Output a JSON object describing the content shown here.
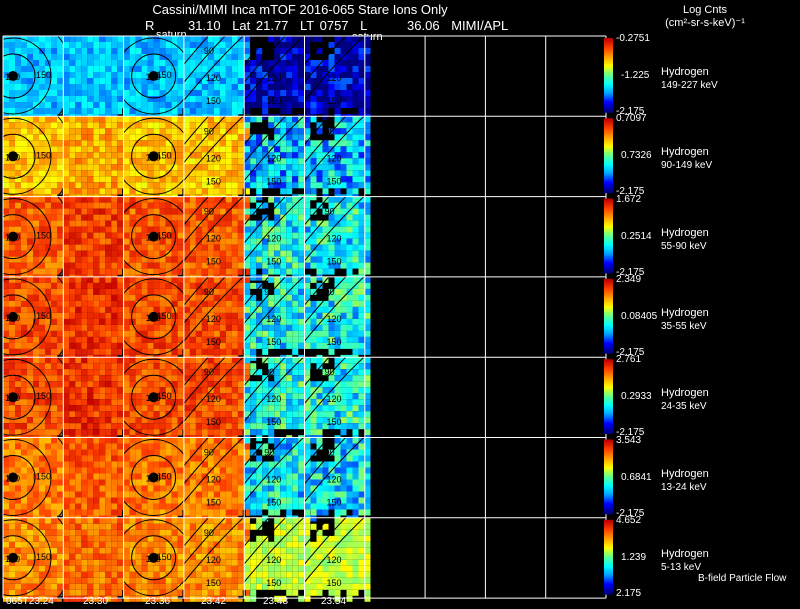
{
  "header": {
    "title": "Cassini/MIMI Inca mTOF  2016-065    Stare    Ions Only",
    "r_label": "R",
    "r_value": "31.10",
    "lat": "Lat 21.77",
    "lt": "LT 0757",
    "l_label": "L",
    "l_value": "36.06",
    "source": "MIMI/APL",
    "saturn_left": "saturn",
    "saturn_right": "saturn"
  },
  "units": {
    "line1": "Log Cnts",
    "line2": "(cm²-sr-s-keV)⁻¹"
  },
  "time_axis": [
    "065T23:24",
    "23:30",
    "23:36",
    "23:42",
    "23:48",
    "23:54"
  ],
  "footer": {
    "bfield_label": "B-field  Particle Flow"
  },
  "contour_labels": [
    "90",
    "120",
    "150"
  ],
  "colorscale": [
    "#000080",
    "#0000ff",
    "#00a0ff",
    "#00ffff",
    "#60ff90",
    "#ffff00",
    "#ffa000",
    "#ff4000",
    "#c00000"
  ],
  "rows": [
    {
      "species": "Hydrogen",
      "energy": "149-227 keV",
      "max": "-0.2751",
      "mid": "-1.225",
      "min": "-2.175",
      "level": 0.3
    },
    {
      "species": "Hydrogen",
      "energy": "90-149 keV",
      "max": "0.7097",
      "mid": "0.7326",
      "min": "-2.175",
      "level": 0.7
    },
    {
      "species": "Hydrogen",
      "energy": "55-90 keV",
      "max": "1.672",
      "mid": "0.2514",
      "min": "-2.175",
      "level": 0.84
    },
    {
      "species": "Hydrogen",
      "energy": "35-55 keV",
      "max": "2.349",
      "mid": "0.08405",
      "min": "-2.175",
      "level": 0.86
    },
    {
      "species": "Hydrogen",
      "energy": "24-35 keV",
      "max": "2.761",
      "mid": "0.2933",
      "min": "-2.175",
      "level": 0.86
    },
    {
      "species": "Hydrogen",
      "energy": "13-24 keV",
      "max": "3.543",
      "mid": "0.6841",
      "min": "-2.175",
      "level": 0.8
    },
    {
      "species": "Hydrogen",
      "energy": "5-13 keV",
      "max": "4.652",
      "mid": "1.239",
      "min": "2.175",
      "level": 0.78
    }
  ]
}
